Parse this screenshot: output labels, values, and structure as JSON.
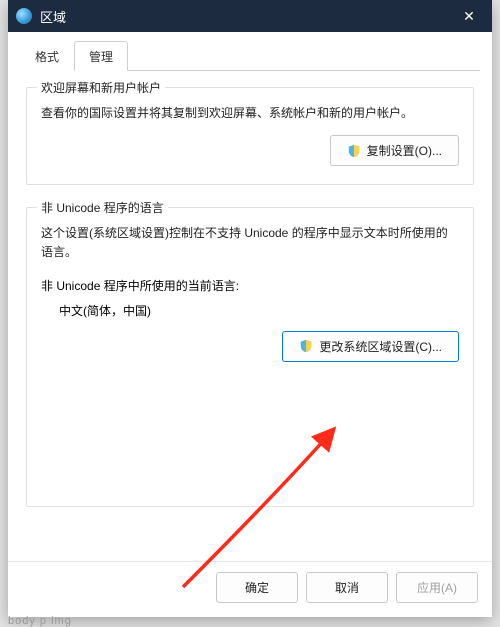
{
  "window": {
    "title": "区域",
    "close_glyph": "✕"
  },
  "tabs": {
    "format": "格式",
    "admin": "管理"
  },
  "group1": {
    "title": "欢迎屏幕和新用户帐户",
    "desc": "查看你的国际设置并将其复制到欢迎屏幕、系统帐户和新的用户帐户。",
    "button": "复制设置(O)..."
  },
  "group2": {
    "title": "非 Unicode 程序的语言",
    "desc": "这个设置(系统区域设置)控制在不支持 Unicode 的程序中显示文本时所使用的语言。",
    "sub": "非 Unicode 程序中所使用的当前语言:",
    "value": "中文(简体，中国)",
    "button": "更改系统区域设置(C)..."
  },
  "footer": {
    "ok": "确定",
    "cancel": "取消",
    "apply": "应用(A)"
  },
  "bg_text": "body  p  img"
}
